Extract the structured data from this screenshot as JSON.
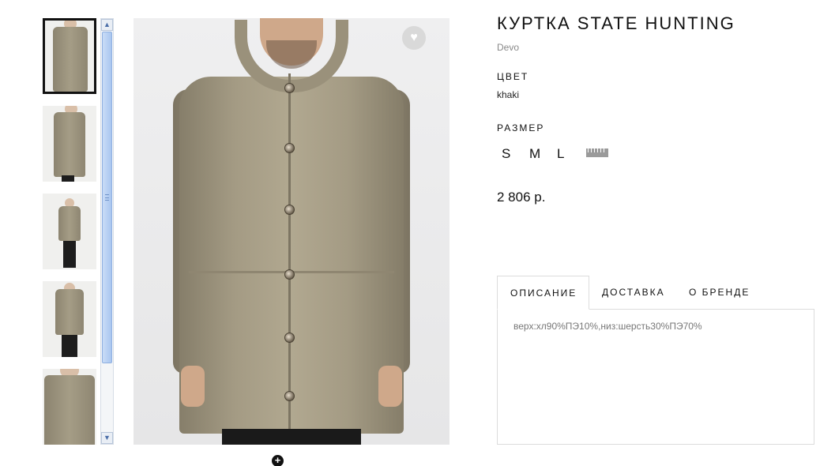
{
  "product": {
    "title": "КУРТКА STATE HUNTING",
    "brand": "Devo",
    "color_label": "ЦВЕТ",
    "color_value": "khaki",
    "size_label": "РАЗМЕР",
    "sizes": [
      "S",
      "M",
      "L"
    ],
    "price": "2 806 р."
  },
  "tabs": [
    {
      "label": "ОПИСАНИЕ",
      "active": true
    },
    {
      "label": "ДОСТАВКА",
      "active": false
    },
    {
      "label": "О БРЕНДЕ",
      "active": false
    }
  ],
  "description": "верх:хл90%ПЭ10%,низ:шерсть30%ПЭ70%",
  "gallery": {
    "thumbnail_count": 5,
    "active_index": 0
  },
  "icons": {
    "favorite": "heart-icon",
    "zoom": "zoom-plus-icon",
    "size_guide": "ruler-icon",
    "scroll_up": "arrow-up-icon",
    "scroll_down": "arrow-down-icon"
  },
  "colors": {
    "coat": "#a49b84",
    "active_border": "#111111",
    "scroll_accent": "#a9c6ef"
  }
}
